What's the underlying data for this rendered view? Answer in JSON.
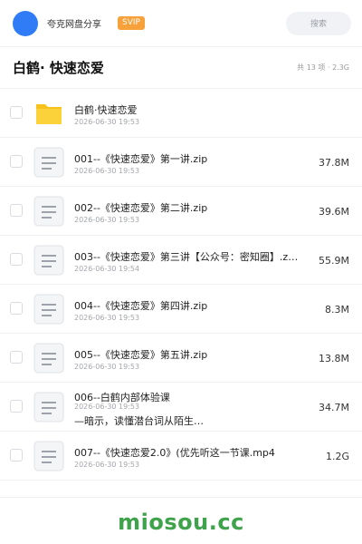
{
  "header": {
    "user_name": "夸克网盘分享",
    "badge": "SVIP",
    "search_placeholder": "搜索",
    "avatar_color": "#2f7cf6",
    "badge_color": "#f7a13a"
  },
  "folder": {
    "title": "白鹤· 快速恋爱",
    "meta": "共 13 项 · 2.3G"
  },
  "files": [
    {
      "icon": "folder-icon",
      "name": "白鹤·快速恋爱",
      "date": "2026-06-30 19:53",
      "size": ""
    },
    {
      "icon": "file-icon",
      "name": "001--《快速恋爱》第一讲.zip",
      "date": "2026-06-30 19:53",
      "size": "37.8M"
    },
    {
      "icon": "file-icon",
      "name": "002--《快速恋爱》第二讲.zip",
      "date": "2026-06-30 19:53",
      "size": "39.6M"
    },
    {
      "icon": "file-icon",
      "name": "003--《快速恋爱》第三讲【公众号：密知圈】.z…",
      "date": "2026-06-30 19:54",
      "size": "55.9M"
    },
    {
      "icon": "file-icon",
      "name": "004--《快速恋爱》第四讲.zip",
      "date": "2026-06-30 19:53",
      "size": "8.3M"
    },
    {
      "icon": "file-icon",
      "name": "005--《快速恋爱》第五讲.zip",
      "date": "2026-06-30 19:53",
      "size": "13.8M"
    },
    {
      "icon": "file-icon",
      "name": "006--白鹤内部体验课",
      "name_line2": "—暗示，读懂潜台词从陌生…",
      "date": "2026-06-30 19:53",
      "size": "34.7M"
    },
    {
      "icon": "file-icon",
      "name": "007--《快速恋爱2.0》(优先听这一节课.mp4",
      "date": "2026-06-30 19:53",
      "size": "1.2G"
    }
  ],
  "watermark": "miosou.cc",
  "colors": {
    "folder": "#f8c21c",
    "watermark": "#3ea34a"
  }
}
